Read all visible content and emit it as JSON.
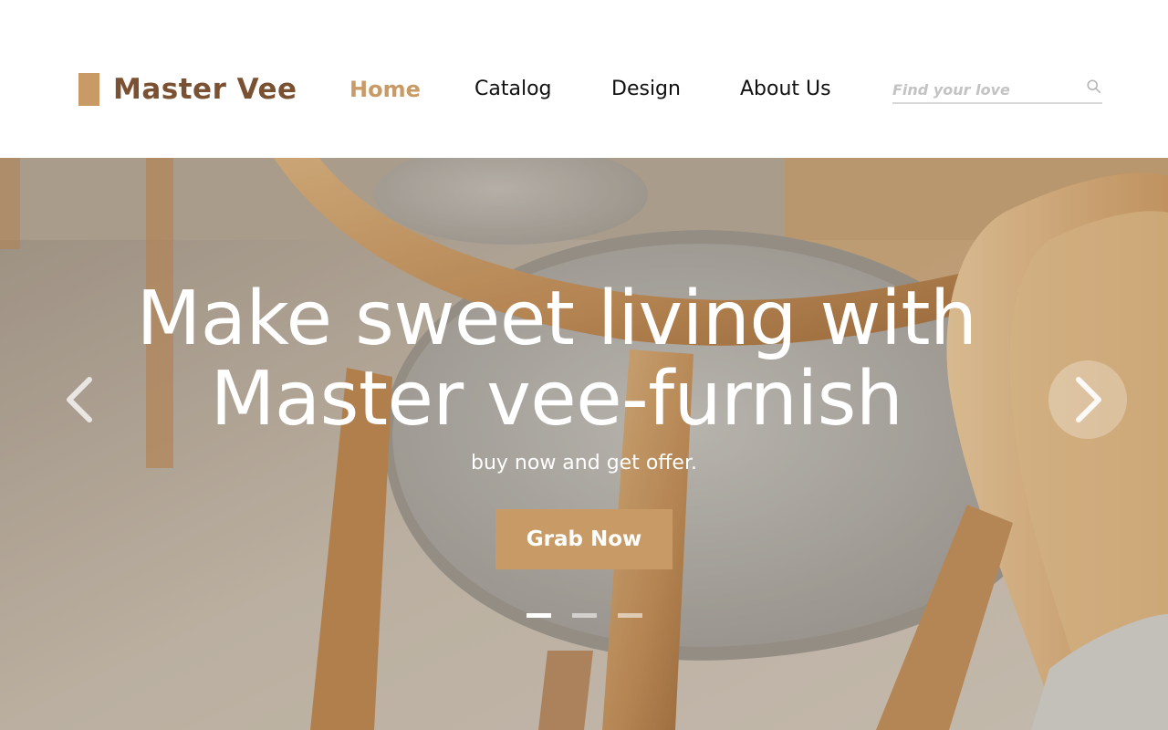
{
  "brand": {
    "name": "Master Vee",
    "accent": "#c89a66",
    "brand_text_color": "#7a5233"
  },
  "nav": {
    "items": [
      {
        "label": "Home",
        "active": true
      },
      {
        "label": "Catalog",
        "active": false
      },
      {
        "label": "Design",
        "active": false
      },
      {
        "label": "About Us",
        "active": false
      }
    ]
  },
  "search": {
    "placeholder": "Find your love",
    "value": "",
    "icon": "search-icon"
  },
  "hero": {
    "title_line1": "Make sweet living with",
    "title_line2": "Master vee-furnish",
    "subtitle": "buy now and get offer.",
    "cta_label": "Grab Now",
    "slides": {
      "count": 3,
      "active_index": 0
    },
    "prev_icon": "chevron-left-icon",
    "next_icon": "chevron-right-icon"
  }
}
